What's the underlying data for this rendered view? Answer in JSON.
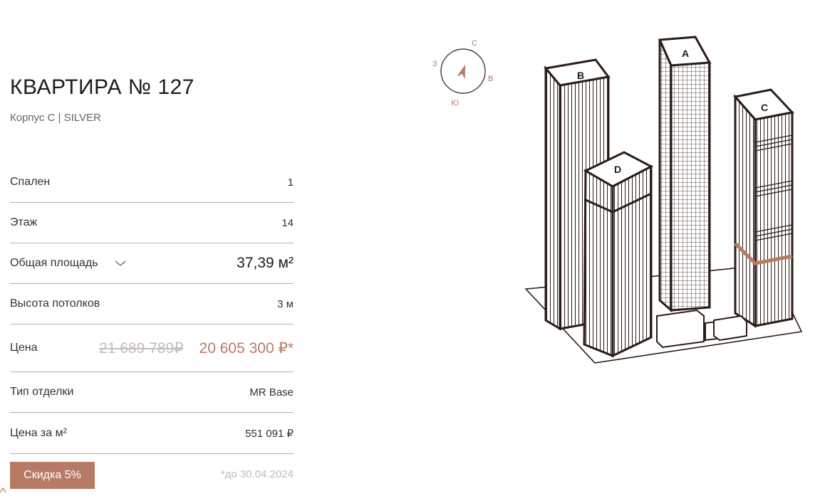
{
  "apartment": {
    "title": "КВАРТИРА № 127",
    "subtitle": "Корпус C | SILVER"
  },
  "specs": {
    "bedrooms_label": "Спален",
    "bedrooms_value": "1",
    "floor_label": "Этаж",
    "floor_value": "14",
    "area_label": "Общая площадь",
    "area_value": "37,39 м²",
    "ceiling_label": "Высота потолков",
    "ceiling_value": "3 м",
    "price_label": "Цена",
    "price_old": "21 689 789₽",
    "price_new": "20 605 300 ₽*",
    "finish_label": "Тип отделки",
    "finish_value": "MR Base",
    "price_per_m2_label": "Цена за м²",
    "price_per_m2_value": "551 091 ₽"
  },
  "promo": {
    "discount_label": "Скидка 5%",
    "deadline": "*до 30.04.2024"
  },
  "compass": {
    "north": "С",
    "east": "В",
    "south": "Ю",
    "west": "З"
  },
  "towers": {
    "a": "A",
    "b": "B",
    "c": "C",
    "d": "D"
  },
  "colors": {
    "accent": "#b77b65",
    "line": "#2b1d17",
    "divider": "#b7aeaa"
  }
}
